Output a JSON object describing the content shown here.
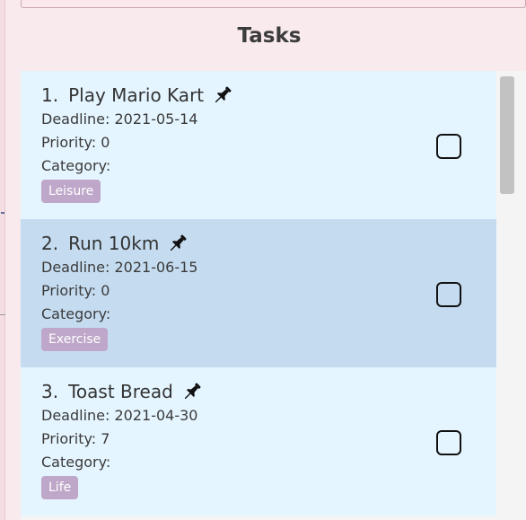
{
  "panel": {
    "title": "Tasks"
  },
  "tasks": [
    {
      "index": "1.",
      "name": "Play Mario Kart",
      "deadline": "Deadline: 2021-05-14",
      "priority": "Priority: 0",
      "category_label": "Category:",
      "tag": "Leisure",
      "pinned": true,
      "checked": false,
      "selected": false
    },
    {
      "index": "2.",
      "name": "Run 10km",
      "deadline": "Deadline: 2021-06-15",
      "priority": "Priority: 0",
      "category_label": "Category:",
      "tag": "Exercise",
      "pinned": true,
      "checked": false,
      "selected": true
    },
    {
      "index": "3.",
      "name": "Toast Bread",
      "deadline": "Deadline: 2021-04-30",
      "priority": "Priority: 7",
      "category_label": "Category:",
      "tag": "Life",
      "pinned": true,
      "checked": false,
      "selected": false
    }
  ],
  "colors": {
    "background": "#f9eaee",
    "card": "#e5f5ff",
    "card_selected": "#c5dcf0",
    "tag": "#bea7c9"
  },
  "icons": {
    "pin": "pushpin-icon",
    "checkbox": "checkbox-icon"
  }
}
